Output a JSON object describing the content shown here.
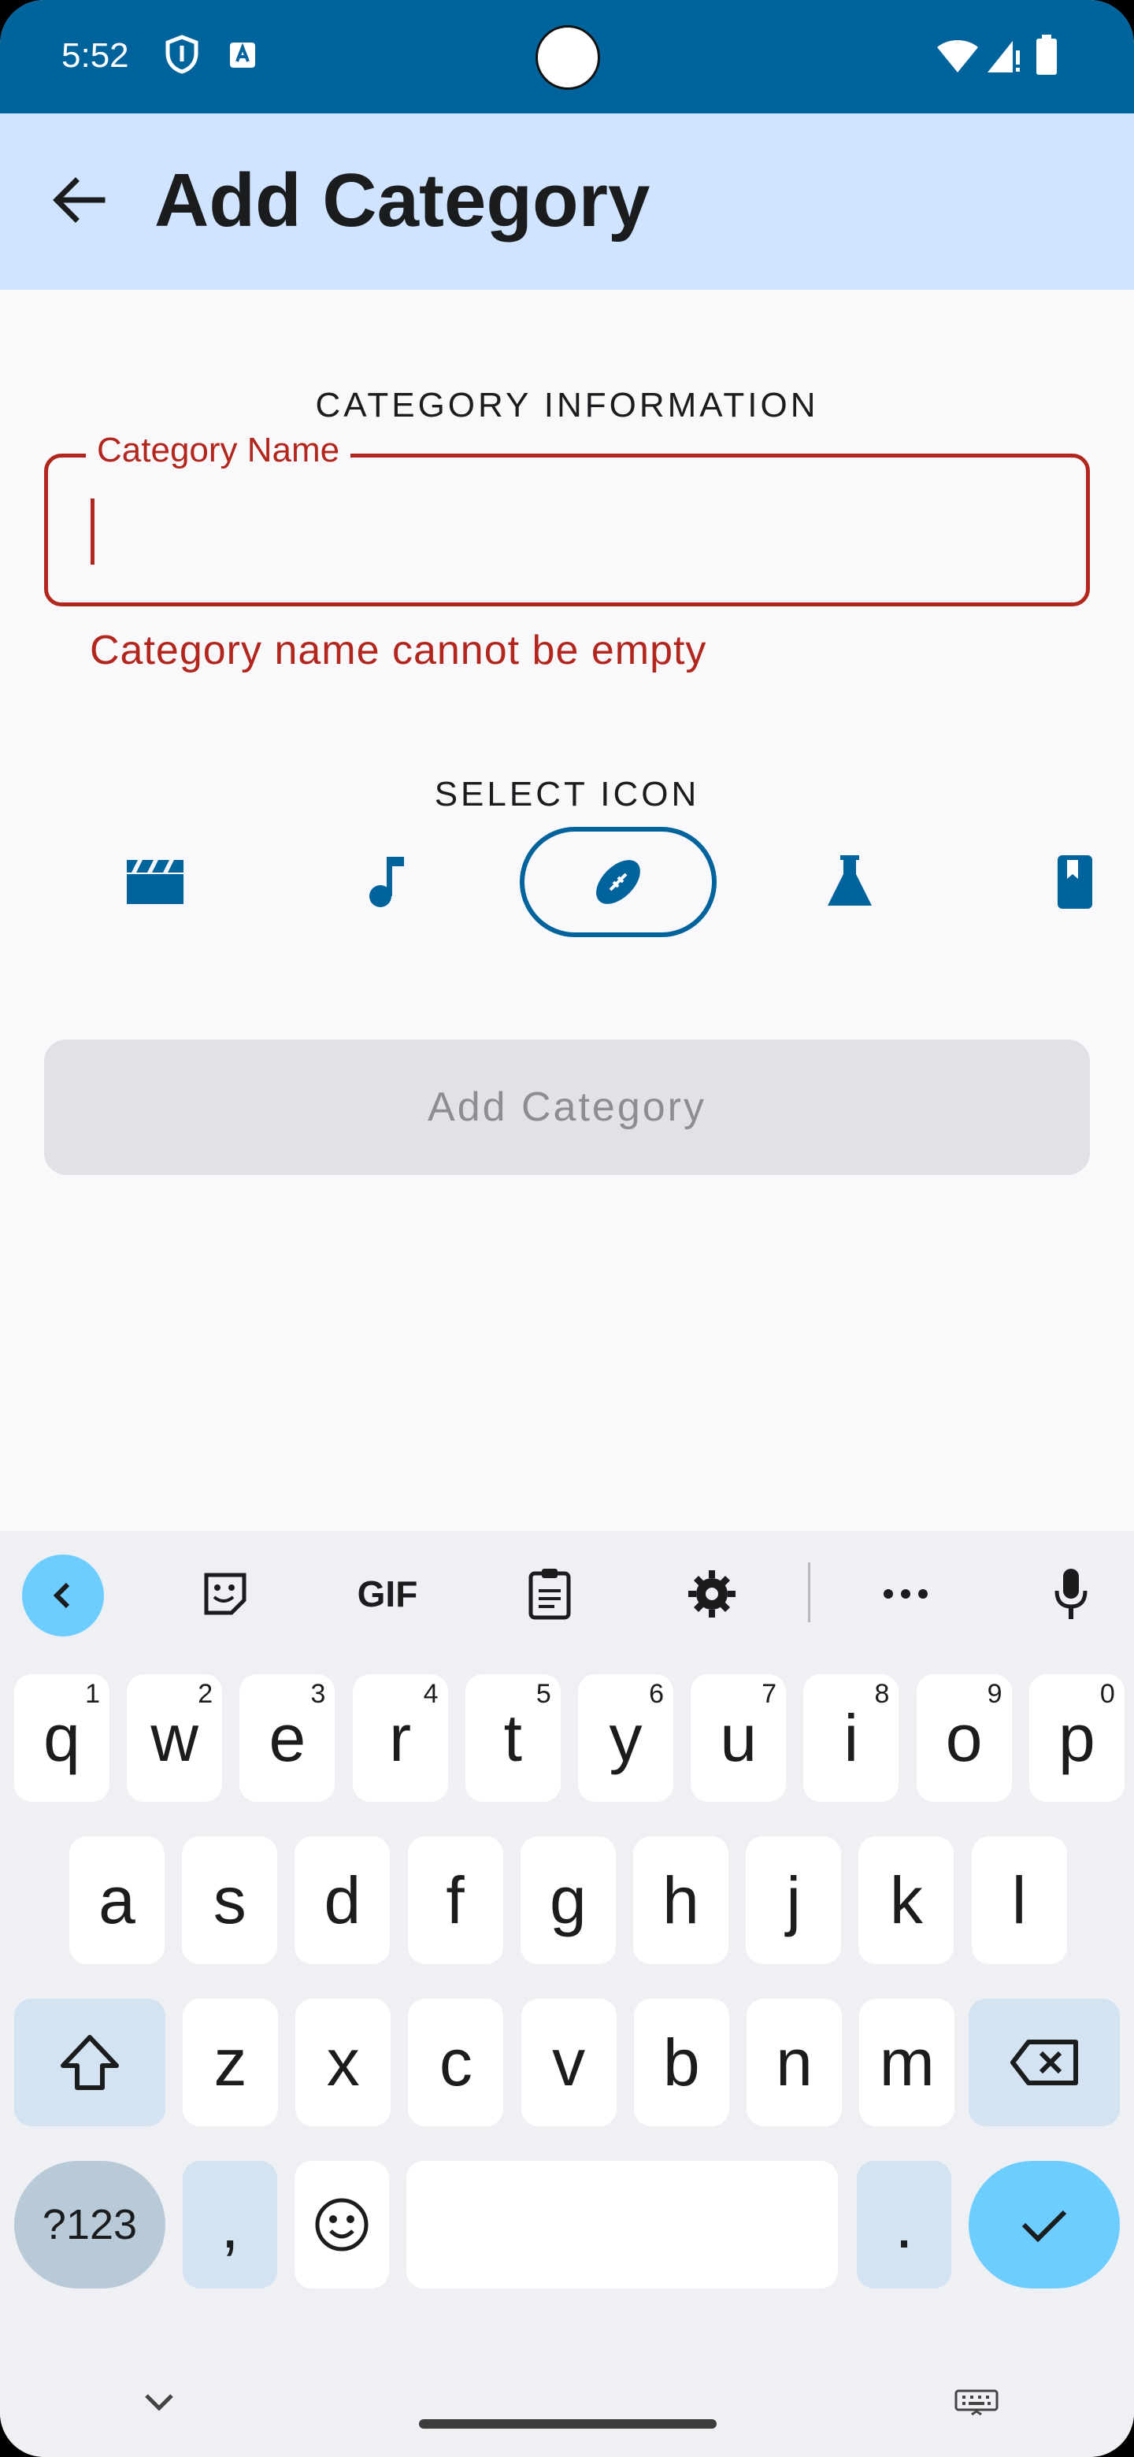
{
  "status_bar": {
    "time": "5:52"
  },
  "app_bar": {
    "title": "Add Category"
  },
  "form": {
    "section_info": "CATEGORY INFORMATION",
    "name_label": "Category Name",
    "name_value": "",
    "error": "Category name cannot be empty",
    "section_icon": "SELECT ICON",
    "icons": [
      "movie-icon",
      "music-note-icon",
      "football-icon",
      "science-flask-icon",
      "book-icon"
    ],
    "selected_icon": "football-icon",
    "submit_label": "Add Category"
  },
  "keyboard": {
    "toolbar": {
      "gif": "GIF"
    },
    "row1": [
      {
        "k": "q",
        "h": "1"
      },
      {
        "k": "w",
        "h": "2"
      },
      {
        "k": "e",
        "h": "3"
      },
      {
        "k": "r",
        "h": "4"
      },
      {
        "k": "t",
        "h": "5"
      },
      {
        "k": "y",
        "h": "6"
      },
      {
        "k": "u",
        "h": "7"
      },
      {
        "k": "i",
        "h": "8"
      },
      {
        "k": "o",
        "h": "9"
      },
      {
        "k": "p",
        "h": "0"
      }
    ],
    "row2": [
      "a",
      "s",
      "d",
      "f",
      "g",
      "h",
      "j",
      "k",
      "l"
    ],
    "row3": [
      "z",
      "x",
      "c",
      "v",
      "b",
      "n",
      "m"
    ],
    "symbols": "?123",
    "comma": ",",
    "period": "."
  },
  "colors": {
    "primary": "#00639b",
    "error": "#b3261e",
    "appbar": "#d1e4ff",
    "accent_key": "#6dcdff"
  }
}
